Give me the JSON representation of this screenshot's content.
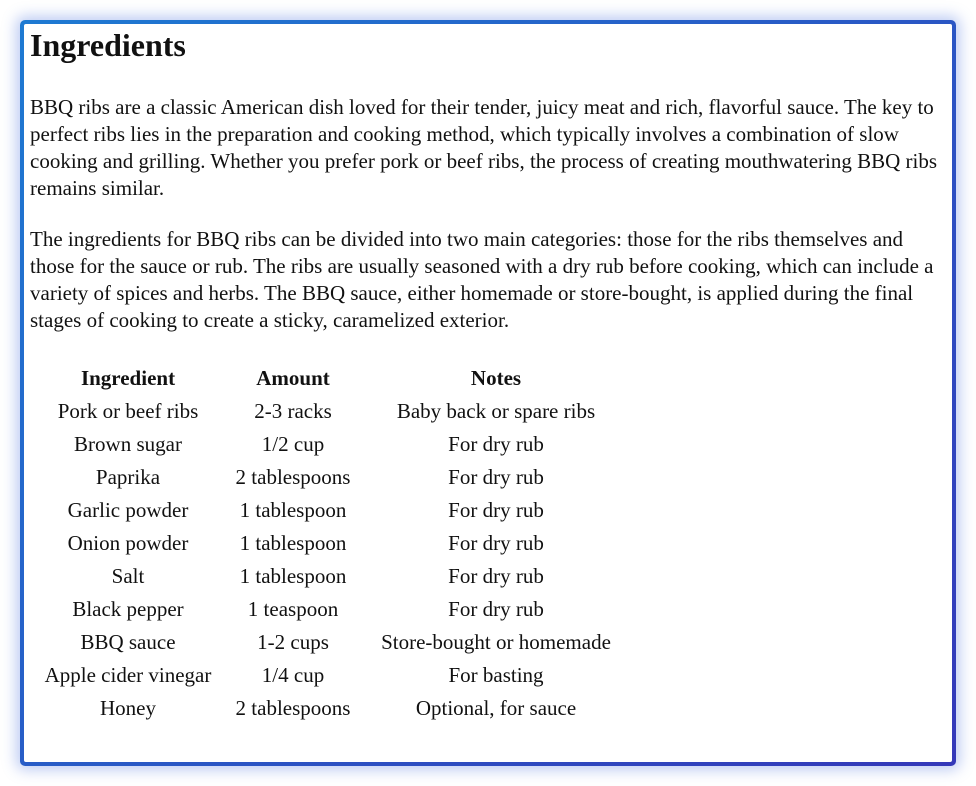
{
  "heading": "Ingredients",
  "paragraphs": [
    "BBQ ribs are a classic American dish loved for their tender, juicy meat and rich, flavorful sauce. The key to perfect ribs lies in the preparation and cooking method, which typically involves a combination of slow cooking and grilling. Whether you prefer pork or beef ribs, the process of creating mouthwatering BBQ ribs remains similar.",
    "The ingredients for BBQ ribs can be divided into two main categories: those for the ribs themselves and those for the sauce or rub. The ribs are usually seasoned with a dry rub before cooking, which can include a variety of spices and herbs. The BBQ sauce, either homemade or store-bought, is applied during the final stages of cooking to create a sticky, caramelized exterior."
  ],
  "table": {
    "headers": [
      "Ingredient",
      "Amount",
      "Notes"
    ],
    "rows": [
      [
        "Pork or beef ribs",
        "2-3 racks",
        "Baby back or spare ribs"
      ],
      [
        "Brown sugar",
        "1/2 cup",
        "For dry rub"
      ],
      [
        "Paprika",
        "2 tablespoons",
        "For dry rub"
      ],
      [
        "Garlic powder",
        "1 tablespoon",
        "For dry rub"
      ],
      [
        "Onion powder",
        "1 tablespoon",
        "For dry rub"
      ],
      [
        "Salt",
        "1 tablespoon",
        "For dry rub"
      ],
      [
        "Black pepper",
        "1 teaspoon",
        "For dry rub"
      ],
      [
        "BBQ sauce",
        "1-2 cups",
        "Store-bought or homemade"
      ],
      [
        "Apple cider vinegar",
        "1/4 cup",
        "For basting"
      ],
      [
        "Honey",
        "2 tablespoons",
        "Optional, for sauce"
      ]
    ]
  },
  "theme": {
    "border_start": "#1e7ad2",
    "border_end": "#3438b9"
  }
}
